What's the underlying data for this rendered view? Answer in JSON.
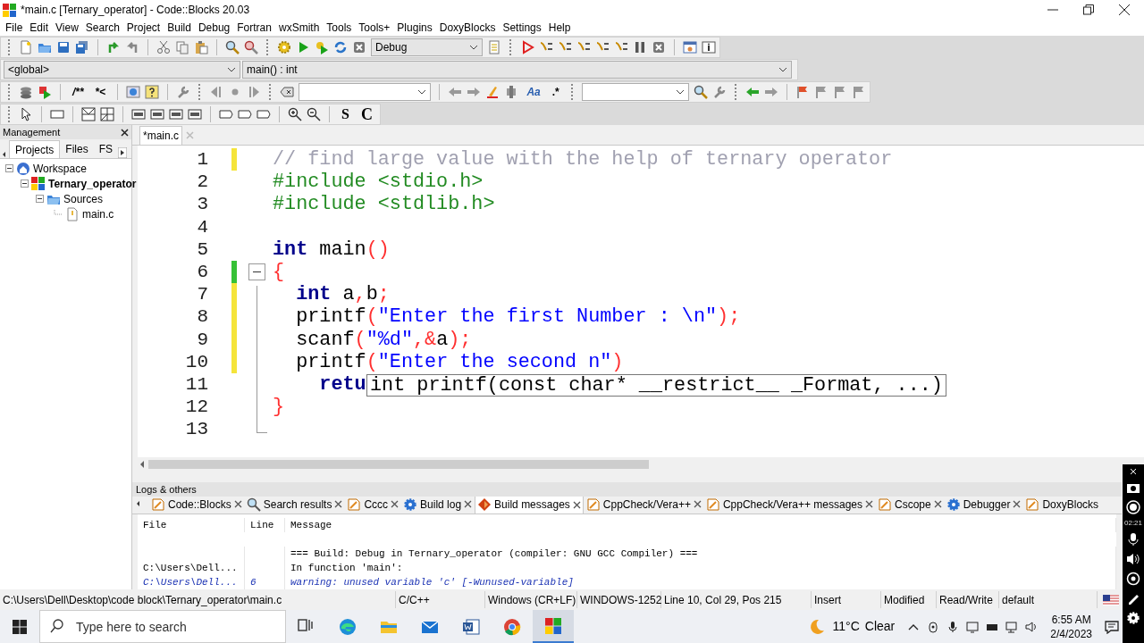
{
  "window": {
    "title": "*main.c [Ternary_operator] - Code::Blocks 20.03"
  },
  "menu": [
    "File",
    "Edit",
    "View",
    "Search",
    "Project",
    "Build",
    "Debug",
    "Fortran",
    "wxSmith",
    "Tools",
    "Tools+",
    "Plugins",
    "DoxyBlocks",
    "Settings",
    "Help"
  ],
  "toolbars": {
    "build_target": "Debug",
    "scope": "<global>",
    "function": "main() : int",
    "glyphs": [
      "/**",
      "*<",
      "Aa",
      ".*",
      "S",
      "C"
    ]
  },
  "management": {
    "title": "Management",
    "tabs": [
      {
        "label": "Projects",
        "selected": true
      },
      {
        "label": "Files",
        "selected": false
      },
      {
        "label": "FS",
        "selected": false
      }
    ],
    "tree": [
      {
        "label": "Workspace",
        "kind": "workspace",
        "children": [
          {
            "label": "Ternary_operator",
            "kind": "project",
            "children": [
              {
                "label": "Sources",
                "kind": "folder",
                "children": [
                  {
                    "label": "main.c",
                    "kind": "file"
                  }
                ]
              }
            ]
          }
        ]
      }
    ]
  },
  "editor": {
    "tabs": [
      {
        "label": "*main.c",
        "selected": true
      }
    ],
    "lines": [
      {
        "number": "1",
        "color": "#f5e43a",
        "tokens": [
          {
            "text": "// find large value with the help of ternary operator",
            "kind": "comment"
          }
        ]
      },
      {
        "number": "2",
        "tokens": [
          {
            "text": "#include <stdio.h>",
            "kind": "preproc"
          }
        ]
      },
      {
        "number": "3",
        "tokens": [
          {
            "text": "#include <stdlib.h>",
            "kind": "preproc"
          }
        ]
      },
      {
        "number": "4"
      },
      {
        "number": "5",
        "tokens": [
          {
            "text": "int",
            "kind": "keyword"
          },
          {
            "text": " main",
            "kind": "plain"
          },
          {
            "text": "()",
            "kind": "operator"
          }
        ]
      },
      {
        "number": "6",
        "color": "#36c136",
        "expanded": true,
        "tokens": [
          {
            "text": "{",
            "kind": "operator"
          }
        ]
      },
      {
        "number": "7",
        "color": "#f5e43a",
        "tokens": [
          {
            "text": "  int",
            "kind": "keyword"
          },
          {
            "text": " a",
            "kind": "plain"
          },
          {
            "text": ",",
            "kind": "operator"
          },
          {
            "text": "b",
            "kind": "plain"
          },
          {
            "text": ";",
            "kind": "operator"
          }
        ]
      },
      {
        "number": "8",
        "color": "#f5e43a",
        "tokens": [
          {
            "text": "  printf",
            "kind": "plain"
          },
          {
            "text": "(",
            "kind": "operator"
          },
          {
            "text": "\"Enter the first Number : \\n\"",
            "kind": "string"
          },
          {
            "text": ");",
            "kind": "operator"
          }
        ]
      },
      {
        "number": "9",
        "color": "#f5e43a",
        "tokens": [
          {
            "text": "  scanf",
            "kind": "plain"
          },
          {
            "text": "(",
            "kind": "operator"
          },
          {
            "text": "\"%d\"",
            "kind": "string"
          },
          {
            "text": ",&",
            "kind": "operator"
          },
          {
            "text": "a",
            "kind": "plain"
          },
          {
            "text": ");",
            "kind": "operator"
          }
        ]
      },
      {
        "number": "10",
        "color": "#f5e43a",
        "tokens": [
          {
            "text": "  printf",
            "kind": "plain"
          },
          {
            "text": "(",
            "kind": "operator"
          },
          {
            "text": "\"Enter the second n\"",
            "kind": "string"
          },
          {
            "text": ")",
            "kind": "operator"
          }
        ]
      },
      {
        "number": "11",
        "tokens": [
          {
            "text": "    retu",
            "kind": "keyword"
          }
        ]
      },
      {
        "number": "12",
        "tokens": [
          {
            "text": "}",
            "kind": "operator"
          }
        ]
      },
      {
        "number": "13"
      }
    ],
    "calltip": "int printf(const char* __restrict__ _Format, ...)"
  },
  "logs": {
    "title": "Logs & others",
    "tabs": [
      {
        "label": "Code::Blocks",
        "kind": "note",
        "selected": false
      },
      {
        "label": "Search results",
        "kind": "search",
        "selected": false
      },
      {
        "label": "Cccc",
        "kind": "note",
        "selected": false
      },
      {
        "label": "Build log",
        "kind": "gear",
        "selected": false
      },
      {
        "label": "Build messages",
        "kind": "build",
        "selected": true
      },
      {
        "label": "CppCheck/Vera++",
        "kind": "note",
        "selected": false
      },
      {
        "label": "CppCheck/Vera++ messages",
        "kind": "note",
        "selected": false
      },
      {
        "label": "Cscope",
        "kind": "note",
        "selected": false
      },
      {
        "label": "Debugger",
        "kind": "gear",
        "selected": false
      },
      {
        "label": "DoxyBlocks",
        "kind": "note",
        "selected": false
      }
    ],
    "columns": [
      "File",
      "Line",
      "Message"
    ],
    "rows": [
      {
        "message": "=== Build: Debug in Ternary_operator (compiler: GNU GCC Compiler) ===",
        "kind": "info"
      },
      {
        "file": "C:\\Users\\Dell...",
        "message": "In function 'main':",
        "kind": "info"
      },
      {
        "file": "C:\\Users\\Dell...",
        "line": "6",
        "message": "warning: unused variable 'c' [-Wunused-variable]",
        "kind": "warning"
      }
    ]
  },
  "status_bar": [
    "C:\\Users\\Dell\\Desktop\\code block\\Ternary_operator\\main.c",
    "C/C++",
    "Windows (CR+LF)",
    "WINDOWS-1252",
    "Line 10, Col 29, Pos 215",
    "Insert",
    "Modified",
    "Read/Write",
    "default"
  ],
  "taskbar": {
    "search_placeholder": "Type here to search",
    "temperature": "11°C",
    "weather": "Clear",
    "time": "6:55 AM",
    "date": "2/4/2023"
  },
  "recorder": {
    "timer": "02:21"
  }
}
